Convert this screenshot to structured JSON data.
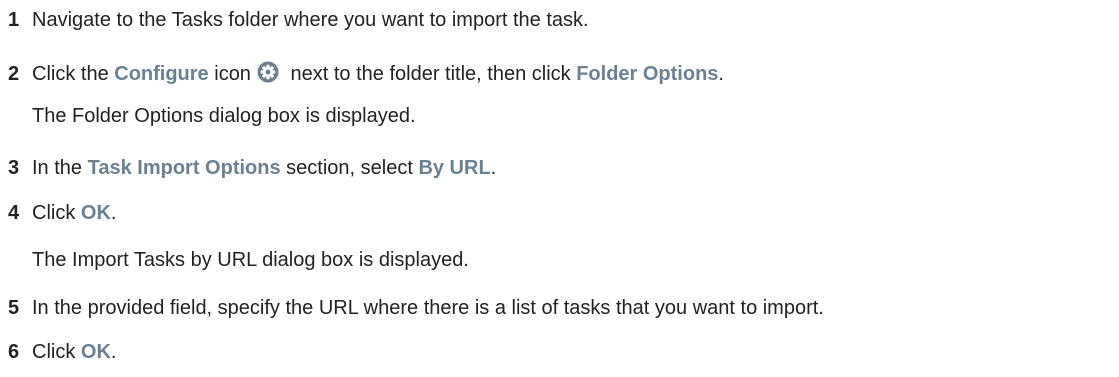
{
  "steps": [
    {
      "number": "1",
      "text": "Navigate to the Tasks folder where you want to import the task."
    },
    {
      "number": "2",
      "parts": {
        "a": "Click the ",
        "b": "Configure",
        "c": " icon",
        "d": " next to the folder title, then click ",
        "e": "Folder Options",
        "f": "."
      },
      "result": "The Folder Options dialog box is displayed.",
      "icon": "gear-icon"
    },
    {
      "number": "3",
      "parts": {
        "a": "In the ",
        "b": "Task Import Options",
        "c": " section, select ",
        "d": "By URL",
        "e": "."
      }
    },
    {
      "number": "4",
      "parts": {
        "a": "Click ",
        "b": "OK",
        "c": "."
      },
      "result": "The Import Tasks by URL dialog box is displayed."
    },
    {
      "number": "5",
      "text": "In the provided field, specify the URL where there is a list of tasks that you want to import."
    },
    {
      "number": "6",
      "parts": {
        "a": "Click ",
        "b": "OK",
        "c": "."
      }
    }
  ],
  "colors": {
    "ui_term": "#6a8191",
    "text": "#222222",
    "icon": "#6e7f8b"
  }
}
